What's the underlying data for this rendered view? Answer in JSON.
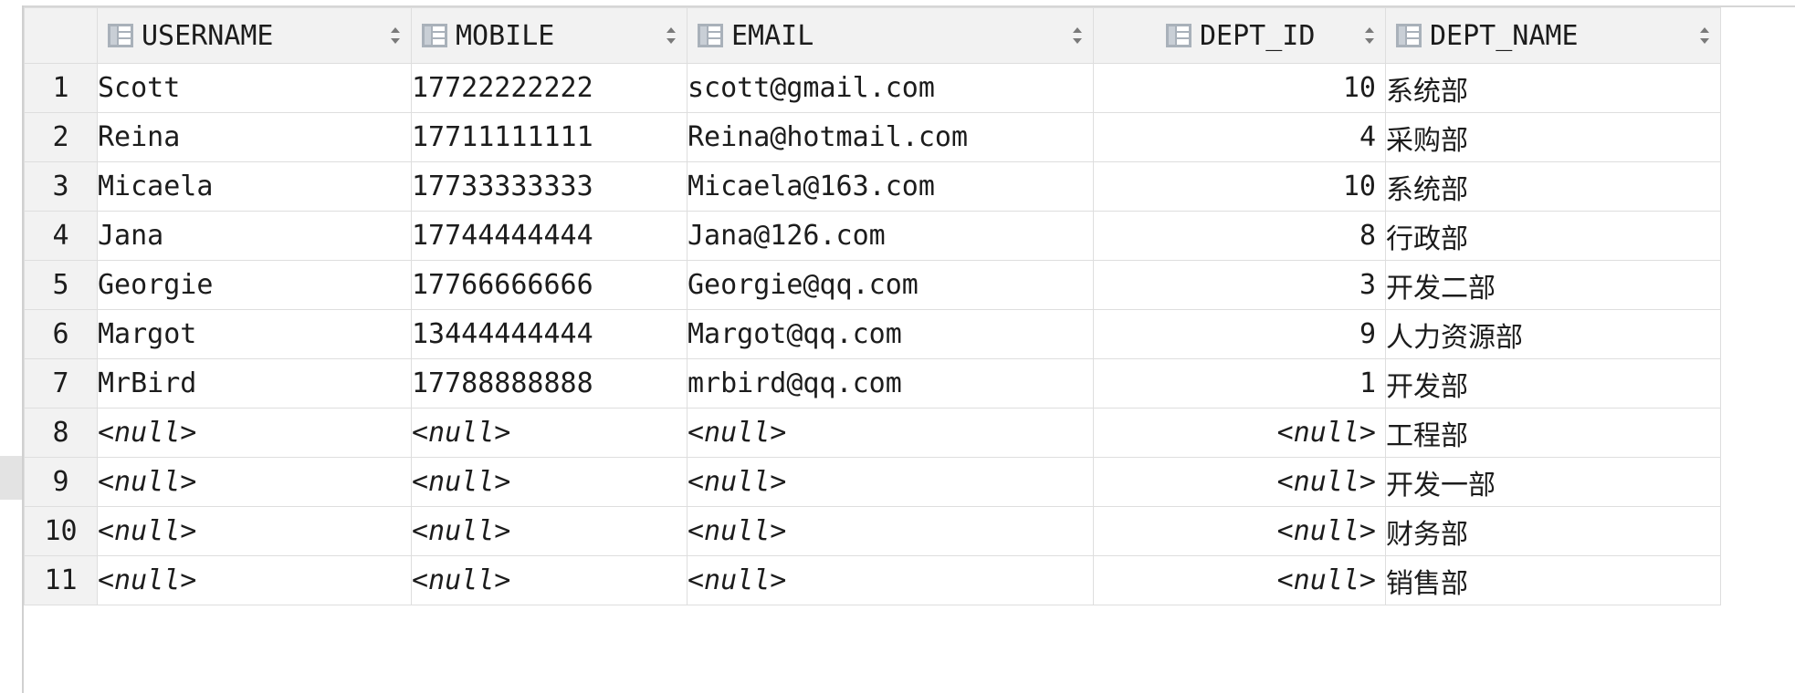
{
  "table": {
    "columns": [
      {
        "label": "USERNAME"
      },
      {
        "label": "MOBILE"
      },
      {
        "label": "EMAIL"
      },
      {
        "label": "DEPT_ID"
      },
      {
        "label": "DEPT_NAME"
      }
    ],
    "null_label": "<null>",
    "rows": [
      {
        "num": "1",
        "username": "Scott",
        "mobile": "17722222222",
        "email": "scott@gmail.com",
        "dept_id": "10",
        "dept_name": "系统部"
      },
      {
        "num": "2",
        "username": "Reina",
        "mobile": "17711111111",
        "email": "Reina@hotmail.com",
        "dept_id": "4",
        "dept_name": "采购部"
      },
      {
        "num": "3",
        "username": "Micaela",
        "mobile": "17733333333",
        "email": "Micaela@163.com",
        "dept_id": "10",
        "dept_name": "系统部"
      },
      {
        "num": "4",
        "username": "Jana",
        "mobile": "17744444444",
        "email": "Jana@126.com",
        "dept_id": "8",
        "dept_name": "行政部"
      },
      {
        "num": "5",
        "username": "Georgie",
        "mobile": "17766666666",
        "email": "Georgie@qq.com",
        "dept_id": "3",
        "dept_name": "开发二部"
      },
      {
        "num": "6",
        "username": "Margot",
        "mobile": "13444444444",
        "email": "Margot@qq.com",
        "dept_id": "9",
        "dept_name": "人力资源部"
      },
      {
        "num": "7",
        "username": "MrBird",
        "mobile": "17788888888",
        "email": "mrbird@qq.com",
        "dept_id": "1",
        "dept_name": "开发部"
      },
      {
        "num": "8",
        "username": null,
        "mobile": null,
        "email": null,
        "dept_id": null,
        "dept_name": "工程部"
      },
      {
        "num": "9",
        "username": null,
        "mobile": null,
        "email": null,
        "dept_id": null,
        "dept_name": "开发一部"
      },
      {
        "num": "10",
        "username": null,
        "mobile": null,
        "email": null,
        "dept_id": null,
        "dept_name": "财务部"
      },
      {
        "num": "11",
        "username": null,
        "mobile": null,
        "email": null,
        "dept_id": null,
        "dept_name": "销售部"
      }
    ]
  }
}
